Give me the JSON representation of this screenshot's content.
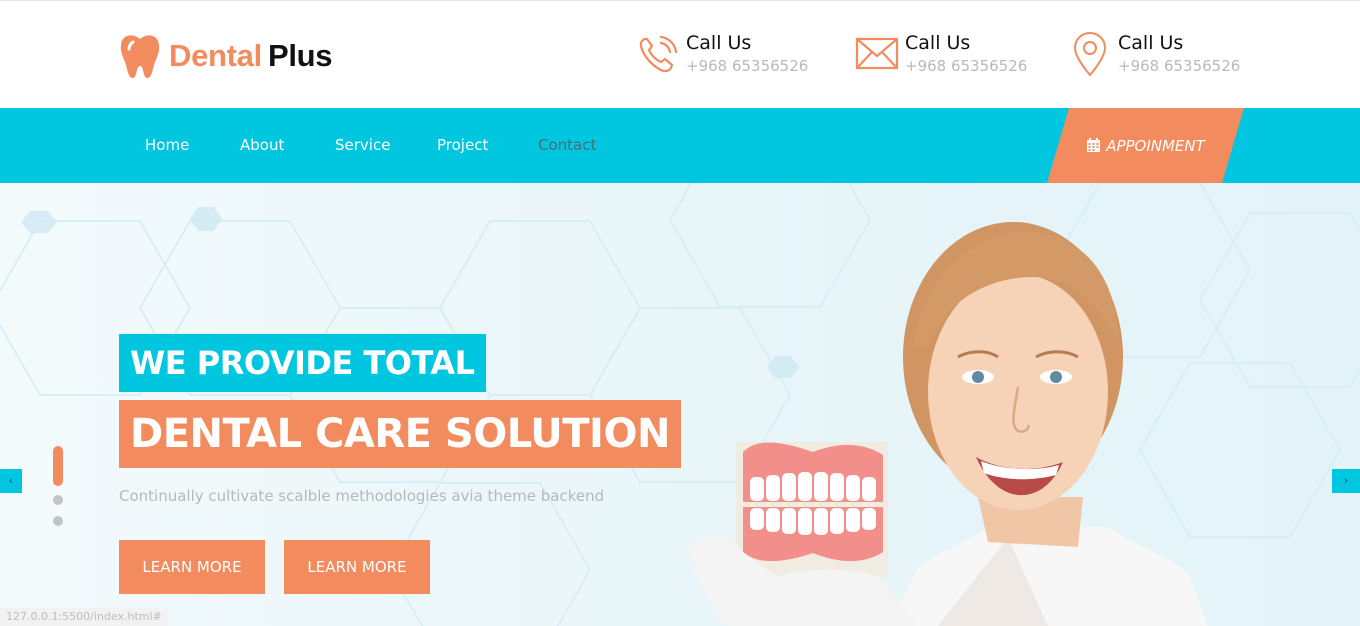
{
  "brand": {
    "word1": "Dental",
    "word2": "Plus"
  },
  "contacts": [
    {
      "title": "Call Us",
      "number": "+968 65356526",
      "icon": "phone-icon"
    },
    {
      "title": "Call Us",
      "number": "+968 65356526",
      "icon": "envelope-icon"
    },
    {
      "title": "Call Us",
      "number": "+968 65356526",
      "icon": "map-pin-icon"
    }
  ],
  "nav": {
    "items": [
      "Home",
      "About",
      "Service",
      "Project",
      "Contact"
    ],
    "appointment": "APPOINMENT"
  },
  "hero": {
    "line1": "WE PROVIDE TOTAL",
    "line2": "DENTAL CARE SOLUTION",
    "subtitle": "Continually cultivate scalble methodologies avia theme backend",
    "button1": "LEARN MORE",
    "button2": "LEARN MORE",
    "prev": "‹",
    "next": "›"
  },
  "status_bar": "127.0.0.1:5500/index.html#",
  "colors": {
    "accent": "#f28b5e",
    "primary": "#00c6df"
  }
}
